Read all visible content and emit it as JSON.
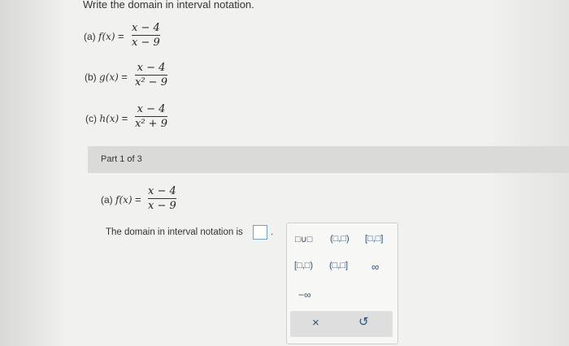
{
  "instruction": "Write the domain in interval notation.",
  "problems": [
    {
      "label": "(a)",
      "func": "f",
      "var": "(x)",
      "numerator": "x − 4",
      "denominator": "x − 9"
    },
    {
      "label": "(b)",
      "func": "g",
      "var": "(x)",
      "numerator": "x − 4",
      "denominator": "x² − 9"
    },
    {
      "label": "(c)",
      "func": "h",
      "var": "(x)",
      "numerator": "x − 4",
      "denominator": "x² + 9"
    }
  ],
  "part": {
    "title": "Part 1 of 3",
    "problem": {
      "label": "(a)",
      "func": "f",
      "var": "(x)",
      "numerator": "x − 4",
      "denominator": "x − 9"
    },
    "prompt": "The domain in interval notation is"
  },
  "palette": {
    "keys": [
      "□∪□",
      "(□,□)",
      "[□,□]",
      "[□,□)",
      "(□,□]",
      "∞",
      "−∞"
    ],
    "clear": "×",
    "undo": "↺"
  }
}
